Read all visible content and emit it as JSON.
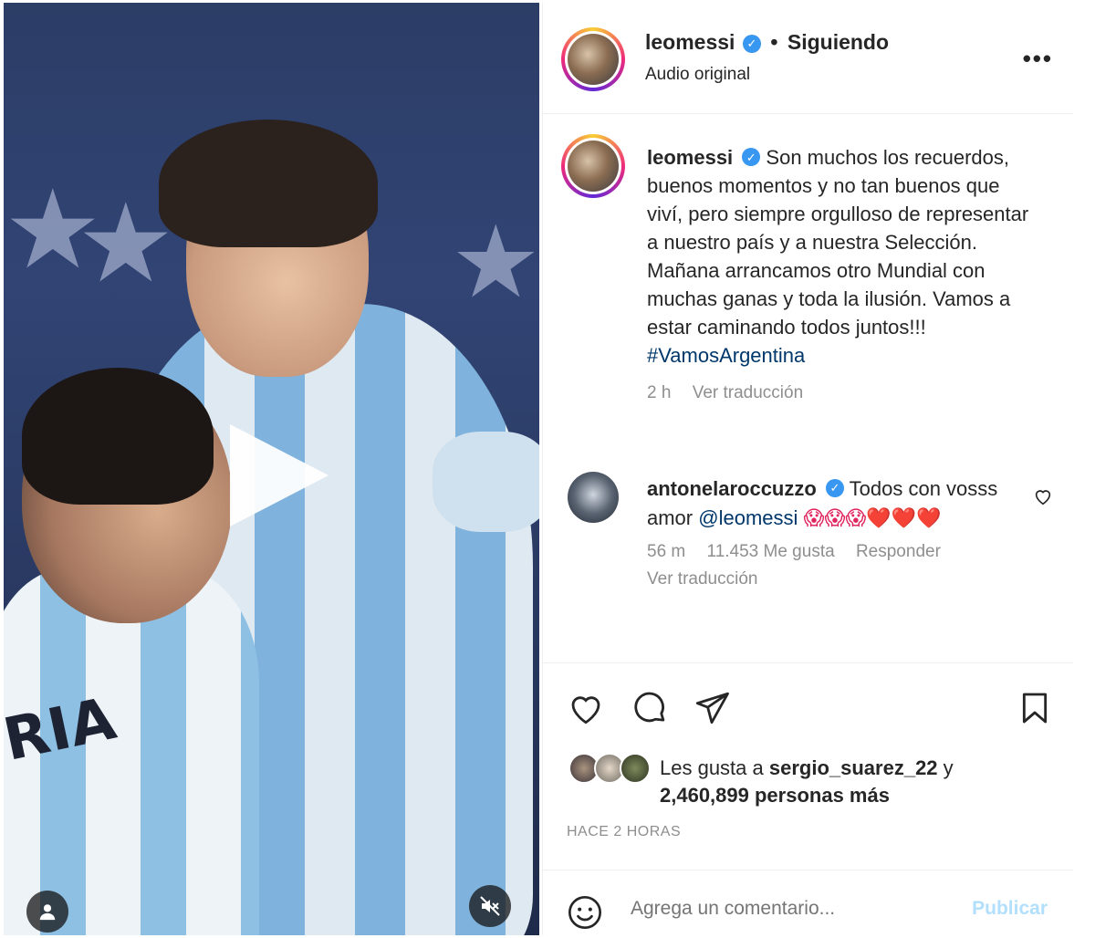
{
  "header": {
    "username": "leomessi",
    "separator": "•",
    "follow_status": "Siguiendo",
    "audio": "Audio original",
    "more": "•••"
  },
  "caption": {
    "username": "leomessi",
    "text": "Son muchos los recuerdos, buenos momentos y no tan buenos que viví, pero siempre orgulloso de representar a nuestro país y a nuestra Selección. Mañana arrancamos otro Mundial con muchas ganas y toda la ilusión. Vamos a estar caminando todos juntos!!!",
    "hashtag": "#VamosArgentina",
    "time": "2 h",
    "translate": "Ver traducción"
  },
  "comment": {
    "username": "antonelaroccuzzo",
    "text": "Todos con vosss amor",
    "mention": "@leomessi",
    "emojis": "😱😱😱❤️❤️❤️",
    "time": "56 m",
    "likes": "11.453 Me gusta",
    "reply": "Responder",
    "translate": "Ver traducción"
  },
  "likes": {
    "prefix": "Les gusta a",
    "user": "sergio_suarez_22",
    "conj": "y",
    "count": "2,460,899 personas más"
  },
  "timestamp": "HACE 2 HORAS",
  "composer": {
    "placeholder": "Agrega un comentario...",
    "publish": "Publicar"
  },
  "icons": {
    "verified": "verified-badge-icon",
    "heart": "heart-icon",
    "comment": "comment-icon",
    "share": "send-icon",
    "save": "bookmark-icon",
    "emoji": "emoji-icon",
    "mute": "muted-speaker-icon",
    "user": "user-tag-icon",
    "play": "play-icon"
  },
  "colors": {
    "link": "#00376b",
    "verified": "#3897f0",
    "publish_disabled": "#b2dffc",
    "muted_text": "#8e8e8e"
  }
}
